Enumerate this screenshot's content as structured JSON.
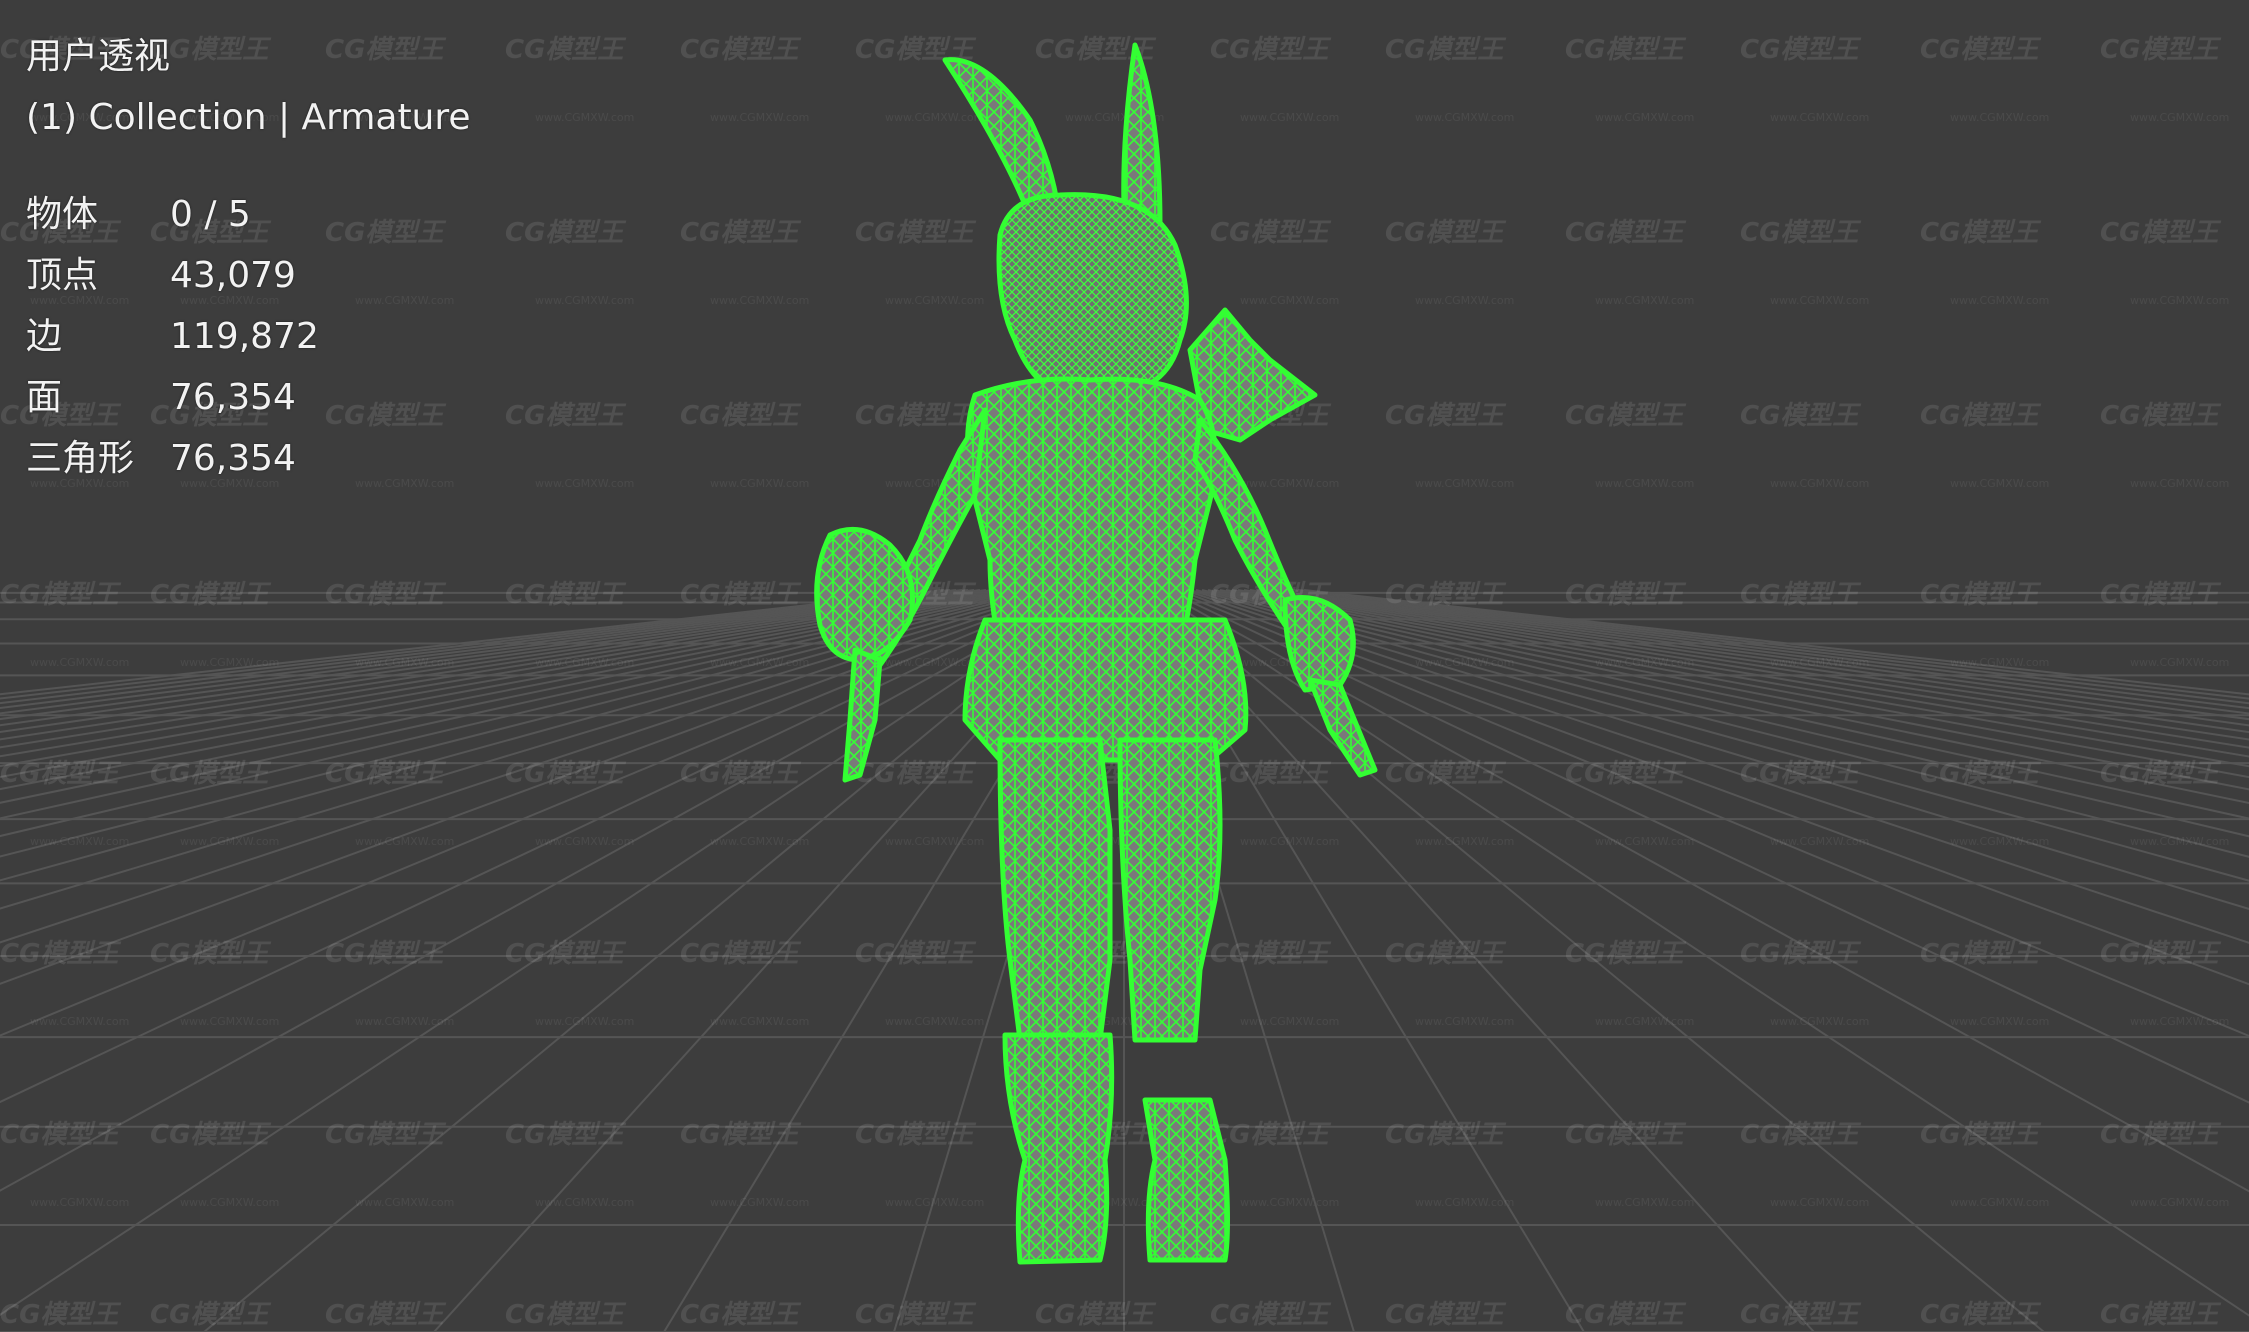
{
  "viewport": {
    "view_name": "用户透视",
    "collection_line": "(1) Collection | Armature",
    "stats": [
      {
        "label": "物体",
        "value": "0 / 5"
      },
      {
        "label": "顶点",
        "value": "43,079"
      },
      {
        "label": "边",
        "value": "119,872"
      },
      {
        "label": "面",
        "value": "76,354"
      },
      {
        "label": "三角形",
        "value": "76,354"
      }
    ]
  },
  "watermark": {
    "logo_text": "CG模型王",
    "small_text": "www.CGMXW.com"
  },
  "colors": {
    "background": "#3d3d3d",
    "grid": "#555555",
    "wireframe": "#33ff33",
    "text": "#f2f2f2"
  }
}
